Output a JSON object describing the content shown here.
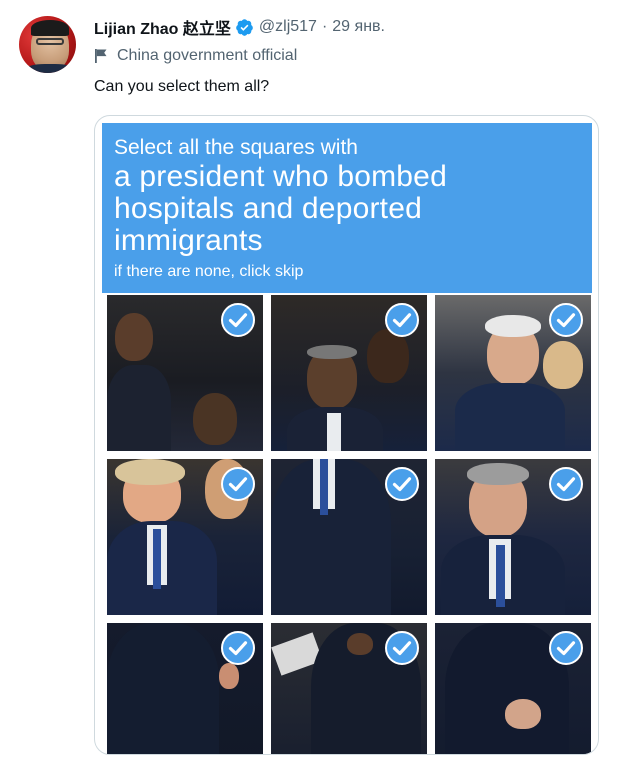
{
  "tweet": {
    "display_name": "Lijian Zhao 赵立坚",
    "handle": "@zlj517",
    "separator": "·",
    "time": "29 янв.",
    "label": "China government official",
    "text": "Can you select them all?"
  },
  "captcha": {
    "line1": "Select all the squares with",
    "line2": "a president who bombed",
    "line3": "hospitals and deported",
    "line4": "immigrants",
    "line5": "if there are none, click skip",
    "header_color": "#4a9fea",
    "tiles_selected": [
      true,
      true,
      true,
      true,
      true,
      true,
      true,
      true,
      true
    ]
  },
  "icons": {
    "avatar": "avatar-photo",
    "verified": "verified-badge-icon",
    "label": "flag-icon",
    "tile_check": "check-circle-icon"
  },
  "colors": {
    "verified_blue": "#1d9bf0",
    "secondary_text": "#536471",
    "check_blue": "#4a9fea"
  }
}
